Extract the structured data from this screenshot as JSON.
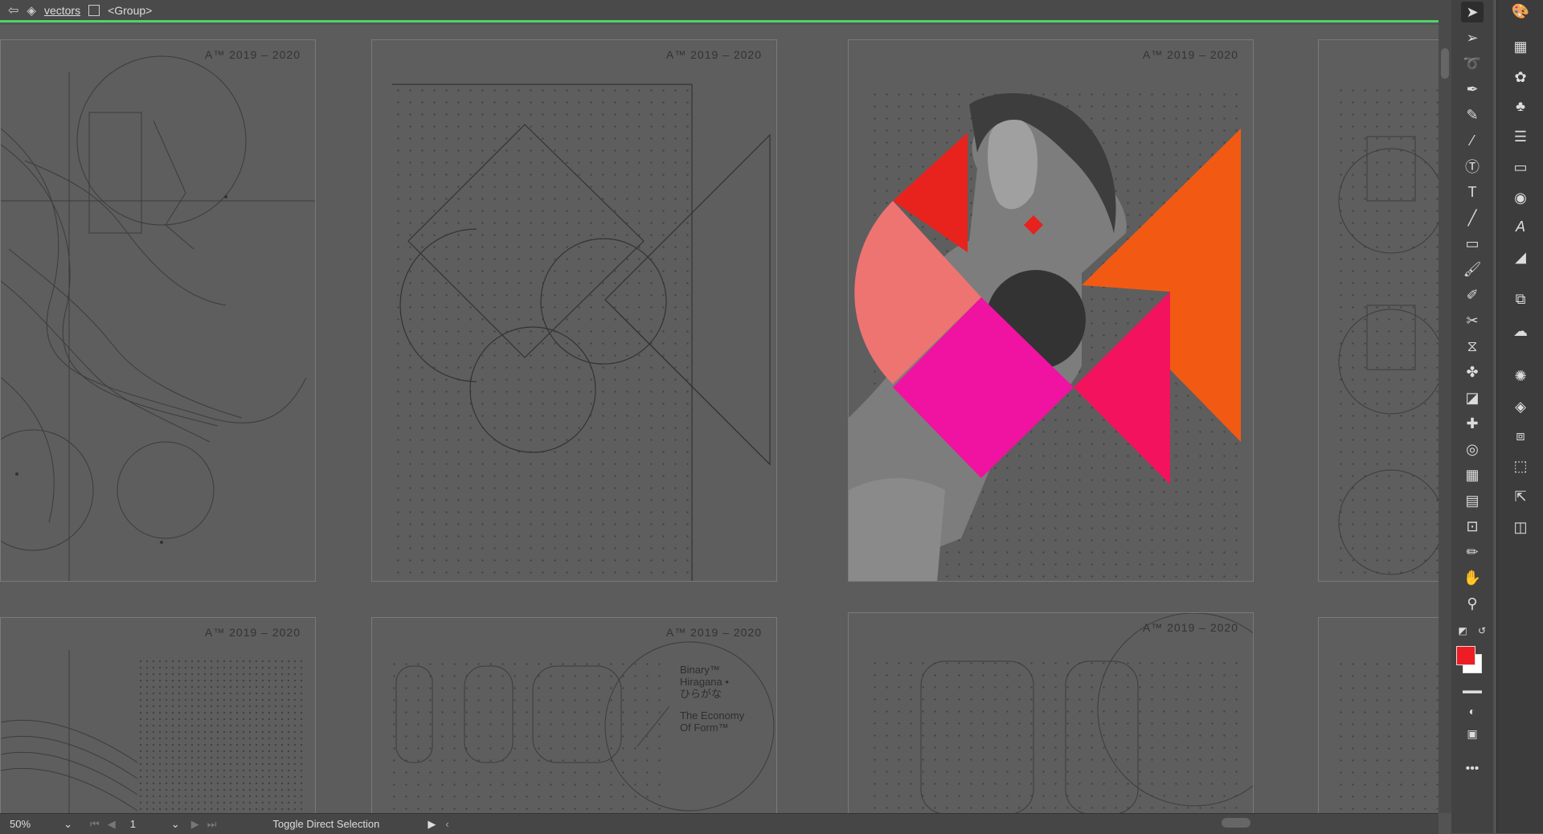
{
  "breadcrumb": {
    "layer_name": "vectors",
    "group_name": "<Group>"
  },
  "artboards": {
    "year_label": "A™ 2019 – 2020",
    "poster_text": {
      "binary": "Binary™",
      "hiragana": "Hiragana •",
      "kana": "ひらがな",
      "economy": "The Economy",
      "of_form": "Of Form™"
    }
  },
  "status": {
    "zoom": "50%",
    "page": "1",
    "label": "Toggle Direct Selection"
  },
  "colors": {
    "accent_green": "#4fd36a",
    "fill": "#ee1d23",
    "red": "#e8221c",
    "salmon": "#ee7472",
    "magenta": "#f012a0",
    "pink_red": "#f3125e",
    "orange": "#f25a14"
  },
  "tools": [
    "selection-tool-icon",
    "direct-selection-tool-icon",
    "lasso-tool-icon",
    "pen-tool-icon",
    "curvature-tool-icon",
    "eyedropper-tool-icon",
    "type-path-tool-icon",
    "type-tool-icon",
    "line-tool-icon",
    "rectangle-tool-icon",
    "paintbrush-tool-icon",
    "shaper-tool-icon",
    "scissors-tool-icon",
    "reflect-tool-icon",
    "warp-tool-icon",
    "free-transform-tool-icon",
    "puppet-warp-tool-icon",
    "shape-builder-tool-icon",
    "mesh-tool-icon",
    "gradient-tool-icon",
    "artboard-tool-icon",
    "slice-tool-icon",
    "hand-tool-icon",
    "zoom-tool-icon"
  ],
  "panels": [
    "color-panel-icon",
    "swatches-panel-icon",
    "brushes-panel-icon",
    "symbols-panel-icon",
    "stroke-panel-icon",
    "gradient-panel-icon",
    "transparency-panel-icon",
    "character-panel-icon",
    "appearance-panel-icon",
    "libraries-panel-icon",
    "cc-libraries-icon",
    "graphic-styles-icon",
    "layers-panel-icon",
    "artboards-panel-icon",
    "transform-panel-icon",
    "export-panel-icon",
    "pathfinder-panel-icon"
  ]
}
